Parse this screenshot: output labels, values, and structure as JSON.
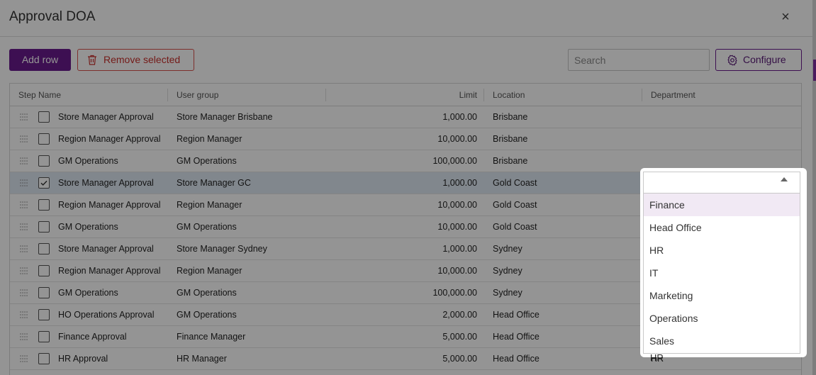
{
  "dialog": {
    "title": "Approval DOA",
    "close_label": "×"
  },
  "toolbar": {
    "add_label": "Add row",
    "remove_label": "Remove selected",
    "search_placeholder": "Search",
    "configure_label": "Configure"
  },
  "table": {
    "columns": [
      "Step Name",
      "User group",
      "Limit",
      "Location",
      "Department"
    ],
    "rows": [
      {
        "step": "Store Manager Approval",
        "group": "Store Manager Brisbane",
        "limit": "1,000.00",
        "location": "Brisbane",
        "department": "",
        "checked": false
      },
      {
        "step": "Region Manager Approval",
        "group": "Region Manager",
        "limit": "10,000.00",
        "location": "Brisbane",
        "department": "",
        "checked": false
      },
      {
        "step": "GM Operations",
        "group": "GM Operations",
        "limit": "100,000.00",
        "location": "Brisbane",
        "department": "",
        "checked": false
      },
      {
        "step": "Store Manager Approval",
        "group": "Store Manager GC",
        "limit": "1,000.00",
        "location": "Gold Coast",
        "department": "",
        "checked": true
      },
      {
        "step": "Region Manager Approval",
        "group": "Region Manager",
        "limit": "10,000.00",
        "location": "Gold Coast",
        "department": "",
        "checked": false
      },
      {
        "step": "GM Operations",
        "group": "GM Operations",
        "limit": "10,000.00",
        "location": "Gold Coast",
        "department": "",
        "checked": false
      },
      {
        "step": "Store Manager Approval",
        "group": "Store Manager Sydney",
        "limit": "1,000.00",
        "location": "Sydney",
        "department": "",
        "checked": false
      },
      {
        "step": "Region Manager Approval",
        "group": "Region Manager",
        "limit": "10,000.00",
        "location": "Sydney",
        "department": "",
        "checked": false
      },
      {
        "step": "GM Operations",
        "group": "GM Operations",
        "limit": "100,000.00",
        "location": "Sydney",
        "department": "",
        "checked": false
      },
      {
        "step": "HO Operations Approval",
        "group": "GM Operations",
        "limit": "2,000.00",
        "location": "Head Office",
        "department": "",
        "checked": false
      },
      {
        "step": "Finance Approval",
        "group": "Finance Manager",
        "limit": "5,000.00",
        "location": "Head Office",
        "department": "",
        "checked": false
      },
      {
        "step": "HR Approval",
        "group": "HR Manager",
        "limit": "5,000.00",
        "location": "Head Office",
        "department": "HR",
        "checked": false
      }
    ]
  },
  "department_dropdown": {
    "value": "",
    "options": [
      "Finance",
      "Head Office",
      "HR",
      "IT",
      "Marketing",
      "Operations",
      "Sales"
    ],
    "highlighted": "Finance"
  },
  "colors": {
    "primary": "#6a1b8e",
    "danger": "#d9534f",
    "selected_row": "#dfe9f3",
    "highlight_option": "#f1e9f4"
  }
}
